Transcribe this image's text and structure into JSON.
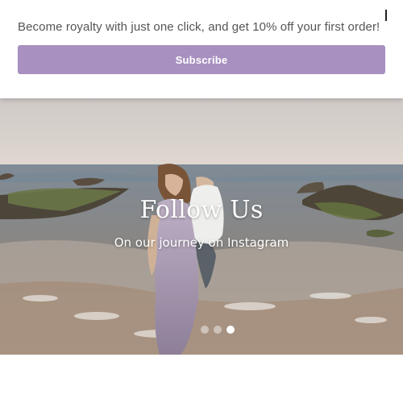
{
  "promo": {
    "text": "Become royalty with just one click, and get 10% off your first order!",
    "button_label": "Subscribe",
    "button_color": "#a890c0"
  },
  "hero": {
    "title": "Follow Us",
    "subtitle": "On our journey on Instagram",
    "slides_count": 3,
    "active_slide": 3
  }
}
